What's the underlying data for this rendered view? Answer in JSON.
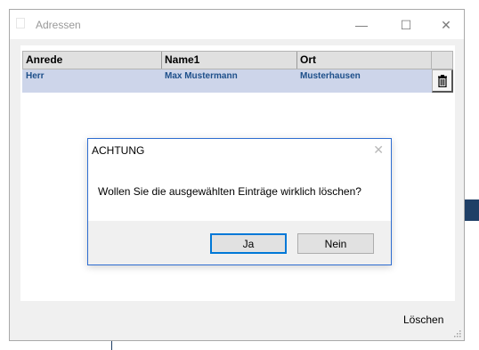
{
  "window": {
    "title": "Adressen",
    "controls": {
      "minimize": "—",
      "maximize": "☐",
      "close": "✕"
    }
  },
  "table": {
    "columns": [
      "Anrede",
      "Name1",
      "Ort"
    ],
    "rows": [
      {
        "anrede": "Herr",
        "name1": "Max Mustermann",
        "ort": "Musterhausen"
      }
    ]
  },
  "footer": {
    "delete_label": "Löschen"
  },
  "dialog": {
    "title": "ACHTUNG",
    "close": "✕",
    "message": "Wollen Sie die ausgewählten Einträge wirklich löschen?",
    "yes_label": "Ja",
    "no_label": "Nein"
  },
  "colors": {
    "accent": "#0078d7",
    "row_highlight": "#cdd5ea",
    "row_text": "#1d4f8a"
  }
}
